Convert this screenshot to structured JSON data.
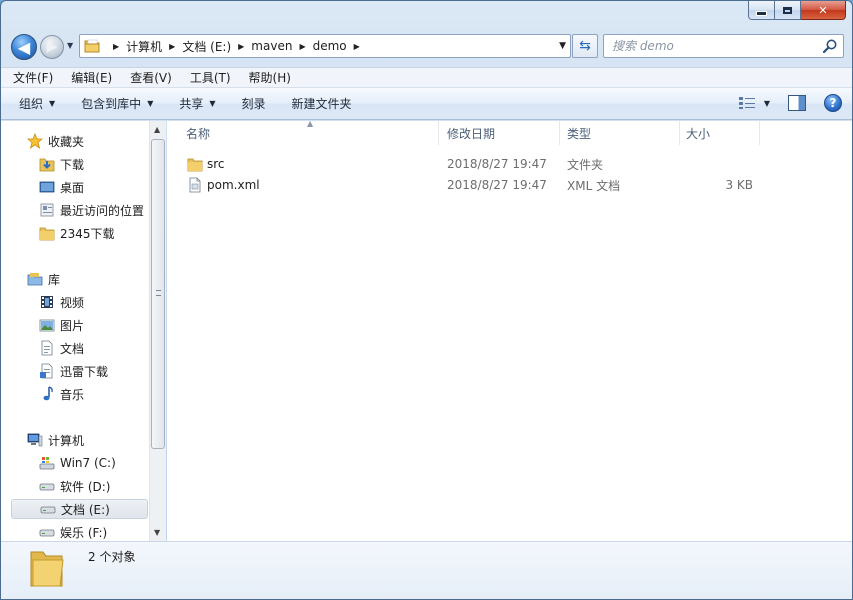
{
  "window": {
    "caption_buttons": [
      "minimize",
      "maximize",
      "close"
    ]
  },
  "address": {
    "crumbs": [
      "计算机",
      "文档 (E:)",
      "maven",
      "demo"
    ]
  },
  "search": {
    "placeholder": "搜索 demo"
  },
  "menu": {
    "items": [
      "文件(F)",
      "编辑(E)",
      "查看(V)",
      "工具(T)",
      "帮助(H)"
    ]
  },
  "commands": {
    "organize": "组织",
    "include_in_library": "包含到库中",
    "share": "共享",
    "burn": "刻录",
    "new_folder": "新建文件夹"
  },
  "nav": {
    "favorites": {
      "label": "收藏夹",
      "items": [
        "下载",
        "桌面",
        "最近访问的位置",
        "2345下载"
      ]
    },
    "libraries": {
      "label": "库",
      "items": [
        "视频",
        "图片",
        "文档",
        "迅雷下载",
        "音乐"
      ]
    },
    "computer": {
      "label": "计算机",
      "items": [
        "Win7 (C:)",
        "软件 (D:)",
        "文档 (E:)",
        "娱乐 (F:)"
      ]
    }
  },
  "columns": {
    "name": "名称",
    "date": "修改日期",
    "type": "类型",
    "size": "大小"
  },
  "files": [
    {
      "name": "src",
      "date": "2018/8/27 19:47",
      "type": "文件夹",
      "size": "",
      "icon": "folder-icon"
    },
    {
      "name": "pom.xml",
      "date": "2018/8/27 19:47",
      "type": "XML 文档",
      "size": "3 KB",
      "icon": "xml-file-icon"
    }
  ],
  "status": {
    "count": "2 个对象"
  },
  "colors": {
    "accent": "#3f86d6",
    "chrome": "#c7daf0",
    "close": "#c2381e"
  }
}
